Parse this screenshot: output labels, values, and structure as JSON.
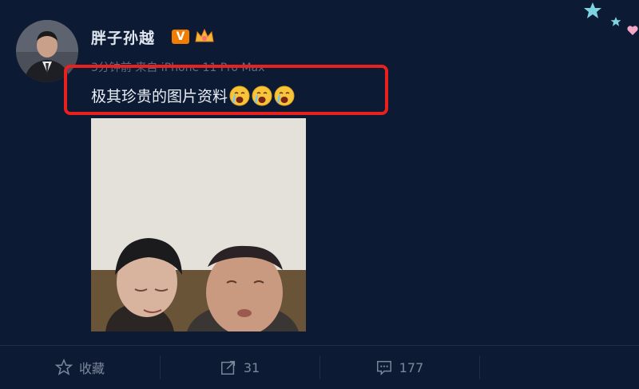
{
  "post": {
    "username": "胖子孙越",
    "verified_badge": "V",
    "meta": "3分钟前 来自 iPhone 11 Pro Max",
    "text": "极其珍贵的图片资料",
    "emoji": [
      "crying-face-icon",
      "crying-face-icon",
      "crying-face-icon"
    ]
  },
  "actions": {
    "favorite_label": "收藏",
    "repost_count": "31",
    "comment_count": "177"
  },
  "colors": {
    "background": "#0c1a33",
    "highlight": "#e8201e",
    "badge": "#f07c00"
  }
}
